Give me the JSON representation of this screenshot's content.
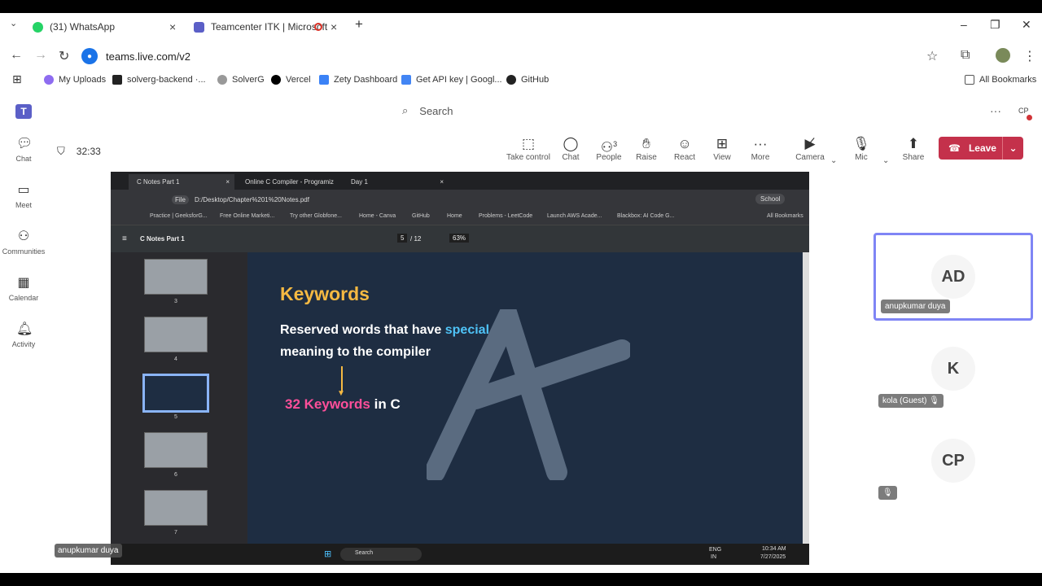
{
  "browser": {
    "tabs": [
      {
        "label": "(31) WhatsApp",
        "color": "#25d366"
      },
      {
        "label": "Teamcenter ITK | Microsoft",
        "color": "#5b5fc7"
      }
    ],
    "url": "teams.live.com/v2",
    "bookmarks": [
      "My Uploads",
      "solverg-backend ·...",
      "SolverG",
      "Vercel",
      "Zety Dashboard",
      "Get API key | Googl...",
      "GitHub"
    ],
    "all_bookmarks": "All Bookmarks"
  },
  "teams": {
    "search_placeholder": "Search",
    "avatar_initials": "CP",
    "rail": [
      "Chat",
      "Meet",
      "Communities",
      "Calendar",
      "Activity"
    ],
    "timer": "32:33",
    "toolbar": [
      "Take control",
      "Chat",
      "People",
      "Raise",
      "React",
      "View",
      "More",
      "Camera",
      "Mic",
      "Share"
    ],
    "people_count": "3",
    "leave_label": "Leave"
  },
  "shared": {
    "tabs": [
      "C Notes Part 1",
      "Online C Compiler - Programiz",
      "Day 1"
    ],
    "file_label": "File",
    "path": "D:/Desktop/Chapter%201%20Notes.pdf",
    "profile": "School",
    "bookmarks": [
      "Practice | GeeksforG...",
      "Free Online Marketi...",
      "Try other Globfone...",
      "Home - Canva",
      "GitHub",
      "Home",
      "Problems - LeetCode",
      "Launch AWS Acade...",
      "Blackbox: AI Code G..."
    ],
    "all_bookmarks": "All Bookmarks",
    "doc_title": "C Notes Part 1",
    "page_current": "5",
    "page_total": "/ 12",
    "zoom": "63%",
    "thumb_numbers": [
      "3",
      "4",
      "5",
      "6",
      "7"
    ],
    "slide": {
      "title": "Keywords",
      "line1": "Reserved words that have ",
      "line1_hl": "special",
      "line2": "meaning to the compiler",
      "kw_number": "32 Keywords",
      "kw_rest": " in C"
    },
    "taskbar_search": "Search",
    "lang1": "ENG",
    "lang2": "IN",
    "time": "10:34 AM",
    "date": "7/27/2025",
    "presenter_label": "anupkumar duya"
  },
  "participants": [
    {
      "initials": "AD",
      "name": "anupkumar duya"
    },
    {
      "initials": "K",
      "name": "kola (Guest)"
    },
    {
      "initials": "CP",
      "name": ""
    }
  ]
}
